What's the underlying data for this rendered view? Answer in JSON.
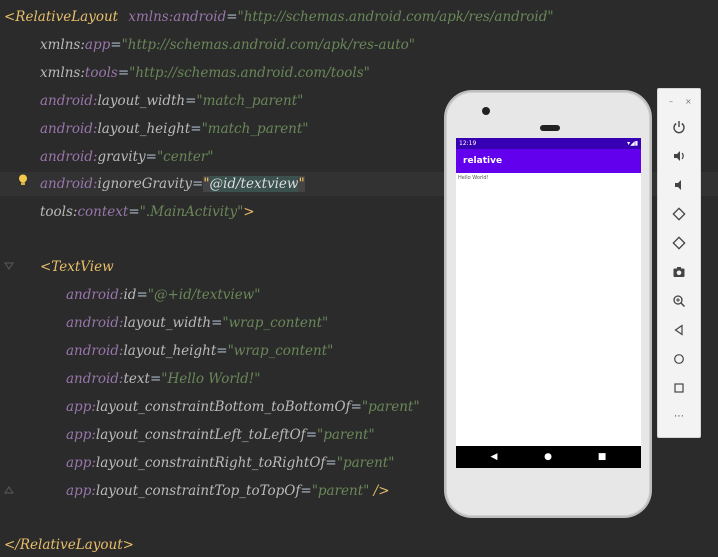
{
  "code": {
    "line1": {
      "open": "<RelativeLayout",
      "ns": "xmlns:",
      "attr": "android",
      "eq": "=",
      "val": "\"http://schemas.android.com/apk/res/android\""
    },
    "line2": {
      "ns": "xmlns:",
      "attr": "app",
      "eq": "=",
      "val": "\"http://schemas.android.com/apk/res-auto\""
    },
    "line3": {
      "ns": "xmlns:",
      "attr": "tools",
      "eq": "=",
      "val": "\"http://schemas.android.com/tools\""
    },
    "line4": {
      "ns": "android:",
      "attr": "layout_width",
      "eq": "=",
      "val": "\"match_parent\""
    },
    "line5": {
      "ns": "android:",
      "attr": "layout_height",
      "eq": "=",
      "val": "\"match_parent\""
    },
    "line6": {
      "ns": "android:",
      "attr": "gravity",
      "eq": "=",
      "val": "\"center\""
    },
    "line7": {
      "ns": "android:",
      "attr": "ignoreGravity",
      "eq": "=",
      "q1": "\"",
      "val": "@id/textview",
      "q2": "\""
    },
    "line8": {
      "ns": "tools:",
      "attr": "context",
      "eq": "=",
      "val": "\".MainActivity\"",
      "close": ">"
    },
    "line10": {
      "open": "<TextView"
    },
    "line11": {
      "ns": "android:",
      "attr": "id",
      "eq": "=",
      "val": "\"@+id/textview\""
    },
    "line12": {
      "ns": "android:",
      "attr": "layout_width",
      "eq": "=",
      "val": "\"wrap_content\""
    },
    "line13": {
      "ns": "android:",
      "attr": "layout_height",
      "eq": "=",
      "val": "\"wrap_content\""
    },
    "line14": {
      "ns": "android:",
      "attr": "text",
      "eq": "=",
      "val": "\"Hello World!\""
    },
    "line15": {
      "ns": "app:",
      "attr": "layout_constraintBottom_toBottomOf",
      "eq": "=",
      "val": "\"parent\""
    },
    "line16": {
      "ns": "app:",
      "attr": "layout_constraintLeft_toLeftOf",
      "eq": "=",
      "val": "\"parent\""
    },
    "line17": {
      "ns": "app:",
      "attr": "layout_constraintRight_toRightOf",
      "eq": "=",
      "val": "\"parent\""
    },
    "line18": {
      "ns": "app:",
      "attr": "layout_constraintTop_toTopOf",
      "eq": "=",
      "val": "\"parent\"",
      "close": " />"
    },
    "line20": {
      "close_tag": "</RelativeLayout>"
    }
  },
  "phone": {
    "status_time": "12:19",
    "status_right": "▾◢▮",
    "app_title": "relative",
    "content_text": "Hello World!",
    "nav_back": "◀",
    "nav_home": "●",
    "nav_recent": "■"
  },
  "toolbar": {
    "minimize": "–",
    "close": "×",
    "more": "⋯"
  },
  "colors": {
    "editor_bg": "#2b2b2b",
    "status_bar": "#3700b3",
    "app_bar": "#6200ee"
  }
}
